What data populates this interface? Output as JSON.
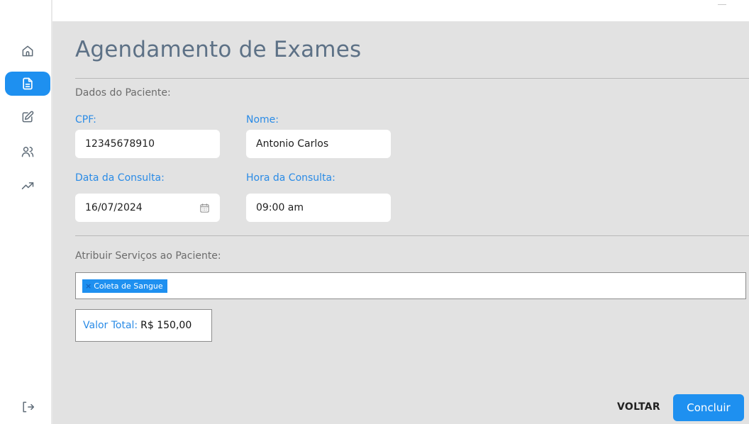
{
  "sidebar": {
    "items": [
      {
        "icon": "home-icon",
        "active": false
      },
      {
        "icon": "document-icon",
        "active": true
      },
      {
        "icon": "edit-icon",
        "active": false
      },
      {
        "icon": "users-icon",
        "active": false
      },
      {
        "icon": "trending-up-icon",
        "active": false
      }
    ],
    "logout_icon": "logout-icon"
  },
  "page": {
    "title": "Agendamento de Exames"
  },
  "patient_section": {
    "label": "Dados do Paciente:",
    "cpf_label": "CPF:",
    "cpf_value": "12345678910",
    "name_label": "Nome:",
    "name_value": "Antonio Carlos",
    "date_label": "Data da Consulta:",
    "date_value": "16/07/2024",
    "time_label": "Hora da Consulta:",
    "time_value": "09:00 am"
  },
  "services_section": {
    "label": "Atribuir Serviços ao Paciente:",
    "selected": [
      "Coleta de Sangue"
    ]
  },
  "total": {
    "label": "Valor Total:",
    "value": "R$ 150,00"
  },
  "actions": {
    "back_label": "VOLTAR",
    "confirm_label": "Concluir"
  },
  "colors": {
    "accent": "#1e90f0",
    "label_blue": "#2a8be6",
    "title": "#5d7186",
    "background": "#e2e2e2"
  }
}
